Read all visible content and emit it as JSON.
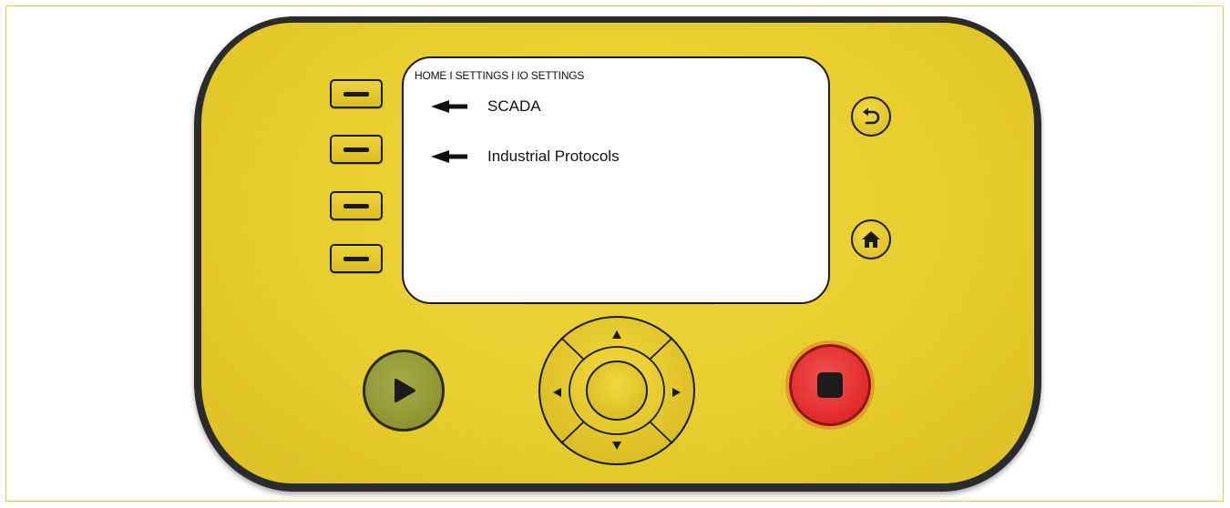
{
  "screen": {
    "breadcrumb": "HOME I SETTINGS I IO SETTINGS",
    "menu_items": [
      {
        "label": "SCADA"
      },
      {
        "label": "Industrial Protocols"
      }
    ]
  },
  "controls": {
    "softkeys": [
      "softkey-1",
      "softkey-2",
      "softkey-3",
      "softkey-4"
    ],
    "icons": {
      "back": "back-arrow-icon",
      "home": "home-icon",
      "play": "play-icon",
      "stop": "stop-icon"
    }
  },
  "colors": {
    "device_body": "#e8cd2e",
    "bezel": "#2b2b2b",
    "play_button": "#8f9431",
    "stop_button": "#e22a2a"
  }
}
